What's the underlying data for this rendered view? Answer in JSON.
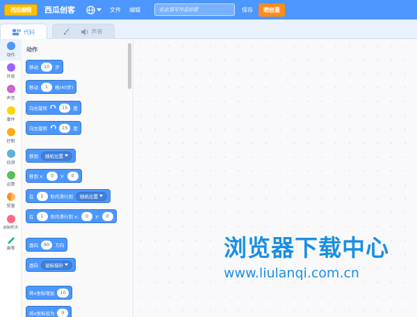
{
  "header": {
    "logo_text": "西瓜编程",
    "brand": "西瓜创客",
    "menu_file": "文件",
    "menu_edit": "编辑",
    "title_placeholder": "在此填写作品标题",
    "save_label": "保存",
    "create_label": "晒创意"
  },
  "tabs": [
    {
      "label": "代码"
    },
    {
      "label": "造型"
    },
    {
      "label": "声音"
    }
  ],
  "categories": [
    {
      "label": "动作",
      "color": "#4c97ff"
    },
    {
      "label": "外观",
      "color": "#9966ff"
    },
    {
      "label": "声音",
      "color": "#cf63cf"
    },
    {
      "label": "事件",
      "color": "#ffd500"
    },
    {
      "label": "控制",
      "color": "#ffab19"
    },
    {
      "label": "侦测",
      "color": "#5cb1d6"
    },
    {
      "label": "运算",
      "color": "#59c059"
    },
    {
      "label": "变量",
      "color": "#ff8c1a"
    },
    {
      "label": "自制积木",
      "color": "#ff6680"
    },
    {
      "label": "画笔",
      "color": "#0fbd8c"
    }
  ],
  "palette": {
    "title": "动作",
    "blocks": {
      "move": {
        "label": "移动",
        "value": "10",
        "suffix": "步"
      },
      "move_grid": {
        "label": "移动",
        "value": "1",
        "suffix": "格(40步)"
      },
      "turn_right": {
        "label": "向右旋转",
        "value": "15",
        "suffix": "度"
      },
      "turn_left": {
        "label": "向左旋转",
        "value": "15",
        "suffix": "度"
      },
      "goto": {
        "label": "移到",
        "dropdown": "随机位置"
      },
      "goto_xy": {
        "label": "移到 x:",
        "x": "0",
        "y_label": "y:",
        "y": "0"
      },
      "glide_to": {
        "label": "在",
        "value": "1",
        "mid": "秒内滑行到",
        "dropdown": "随机位置"
      },
      "glide_xy": {
        "label": "在",
        "value": "1",
        "mid": "秒内滑行到 x:",
        "x": "0",
        "y_label": "y:",
        "y": "0"
      },
      "point_dir": {
        "label": "面向",
        "value": "90",
        "suffix": "方向"
      },
      "point_towards": {
        "label": "面向",
        "dropdown": "鼠标指针"
      },
      "change_x": {
        "label": "将x坐标增加",
        "value": "10"
      },
      "set_x": {
        "label": "将x坐标设为",
        "value": "0"
      }
    }
  },
  "watermark": {
    "line1": "浏览器下载中心",
    "line2": "www.liulanqi.com.cn"
  },
  "colors": {
    "topbar": "#4c97ff",
    "create_button": "#ff8c1a",
    "motion_block": "#4c97ff"
  }
}
